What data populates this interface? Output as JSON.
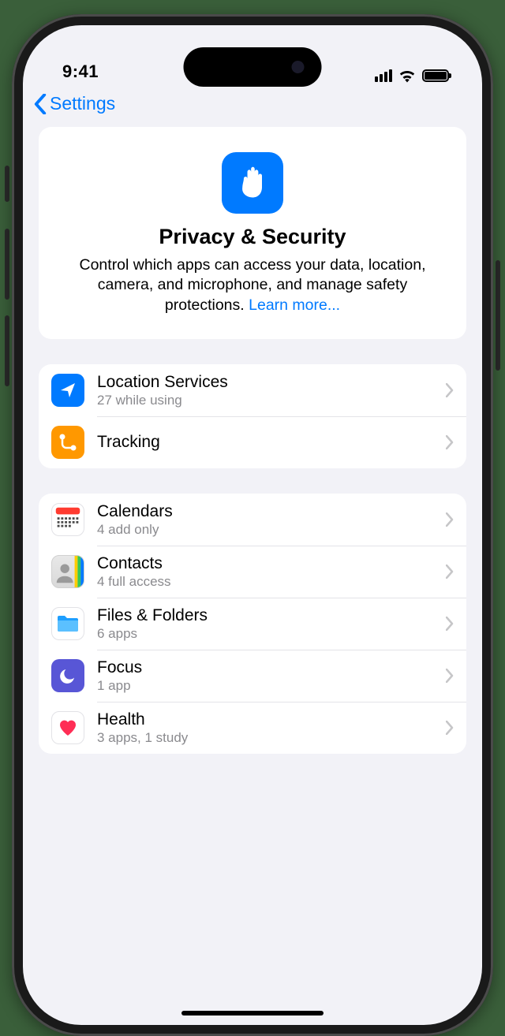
{
  "status": {
    "time": "9:41"
  },
  "nav": {
    "back_label": "Settings"
  },
  "hero": {
    "title": "Privacy & Security",
    "description": "Control which apps can access your data, location, camera, and microphone, and manage safety protections. ",
    "learn_more": "Learn more..."
  },
  "group1": {
    "items": [
      {
        "label": "Location Services",
        "sub": "27 while using"
      },
      {
        "label": "Tracking",
        "sub": ""
      }
    ]
  },
  "group2": {
    "items": [
      {
        "label": "Calendars",
        "sub": "4 add only"
      },
      {
        "label": "Contacts",
        "sub": "4 full access"
      },
      {
        "label": "Files & Folders",
        "sub": "6 apps"
      },
      {
        "label": "Focus",
        "sub": "1 app"
      },
      {
        "label": "Health",
        "sub": "3 apps, 1 study"
      }
    ]
  }
}
